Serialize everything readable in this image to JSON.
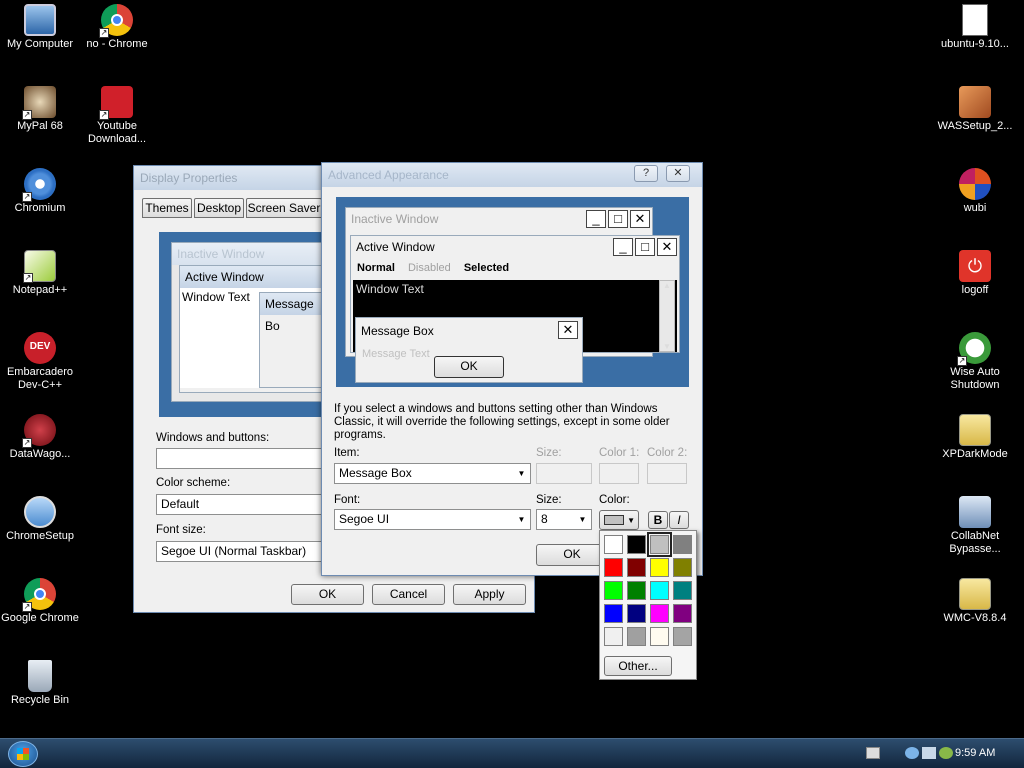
{
  "desktop_icons_left": [
    {
      "label": "My Computer"
    },
    {
      "label": "MyPal 68"
    },
    {
      "label": "Chromium"
    },
    {
      "label": "Notepad++"
    },
    {
      "label": "Embarcadero Dev-C++"
    },
    {
      "label": "DataWago..."
    },
    {
      "label": "ChromeSetup"
    },
    {
      "label": "Google Chrome"
    },
    {
      "label": "Recycle Bin"
    }
  ],
  "desktop_icons_col2": [
    {
      "label": "no - Chrome"
    },
    {
      "label": "Youtube Download..."
    }
  ],
  "desktop_icons_right": [
    {
      "label": "ubuntu-9.10..."
    },
    {
      "label": "WASSetup_2..."
    },
    {
      "label": "wubi"
    },
    {
      "label": "logoff"
    },
    {
      "label": "Wise Auto Shutdown"
    },
    {
      "label": "XPDarkMode"
    },
    {
      "label": "CollabNet Bypasse..."
    },
    {
      "label": "WMC-V8.8.4"
    }
  ],
  "display_properties": {
    "title": "Display Properties",
    "tabs": [
      "Themes",
      "Desktop",
      "Screen Saver"
    ],
    "preview": {
      "inactive_title": "Inactive Window",
      "active_title": "Active Window",
      "window_text": "Window Text",
      "message_box": "Message Bo"
    },
    "windows_buttons_label": "Windows and buttons:",
    "color_scheme_label": "Color scheme:",
    "color_scheme_value": "Default",
    "font_size_label": "Font size:",
    "font_size_value": "Segoe UI (Normal Taskbar)",
    "ok": "OK",
    "cancel": "Cancel",
    "apply": "Apply"
  },
  "advanced_appearance": {
    "title": "Advanced Appearance",
    "help": "?",
    "close": "✕",
    "preview": {
      "inactive_title": "Inactive Window",
      "active_title": "Active Window",
      "menu_normal": "Normal",
      "menu_disabled": "Disabled",
      "menu_selected": "Selected",
      "window_text": "Window Text",
      "msgbox_title": "Message Box",
      "msgbox_text": "Message Text",
      "msgbox_ok": "OK"
    },
    "info_text": "If you select a windows and buttons setting other than Windows Classic, it will override the following settings, except in some older programs.",
    "item_label": "Item:",
    "item_value": "Message Box",
    "size_label": "Size:",
    "color1_label": "Color 1:",
    "color2_label": "Color 2:",
    "font_label": "Font:",
    "font_value": "Segoe UI",
    "font_size_label": "Size:",
    "font_size_value": "8",
    "color_label": "Color:",
    "bold": "B",
    "italic": "I",
    "ok": "OK"
  },
  "palette": {
    "colors": [
      "#ffffff",
      "#000000",
      "#c0c0c0",
      "#808080",
      "#ff0000",
      "#800000",
      "#ffff00",
      "#808000",
      "#00ff00",
      "#008000",
      "#00ffff",
      "#008080",
      "#0000ff",
      "#000080",
      "#ff00ff",
      "#800080",
      "#f0f0f0",
      "#a0a0a0",
      "#fffbf0",
      "#a4a4a4"
    ],
    "selected_index": 2,
    "other_label": "Other..."
  },
  "taskbar": {
    "clock": "9:59 AM"
  }
}
